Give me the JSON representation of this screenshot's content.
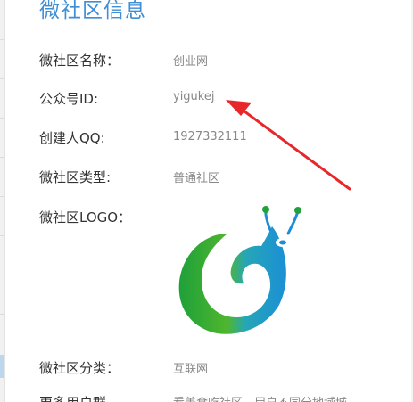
{
  "page": {
    "title": "微社区信息"
  },
  "fields": [
    {
      "label": "微社区名称：",
      "value": "创业网"
    },
    {
      "label": "公众号ID:",
      "value": "yigukej"
    },
    {
      "label": "创建人QQ:",
      "value": "1927332111"
    },
    {
      "label": "微社区类型:",
      "value": "普通社区"
    },
    {
      "label": "微社区LOGO：",
      "value": ""
    },
    {
      "label": "微社区分类：",
      "value": "互联网"
    },
    {
      "label": "更多用户群",
      "value": "看美食吃社区，用户不同分地域城"
    }
  ],
  "colors": {
    "title": "#3f8ed6",
    "arrow": "#e8272b",
    "logo_green": "#1fa23c",
    "logo_blue": "#1b8fd6"
  },
  "icons": {
    "logo": "snail-logo",
    "annotation": "red-arrow"
  }
}
